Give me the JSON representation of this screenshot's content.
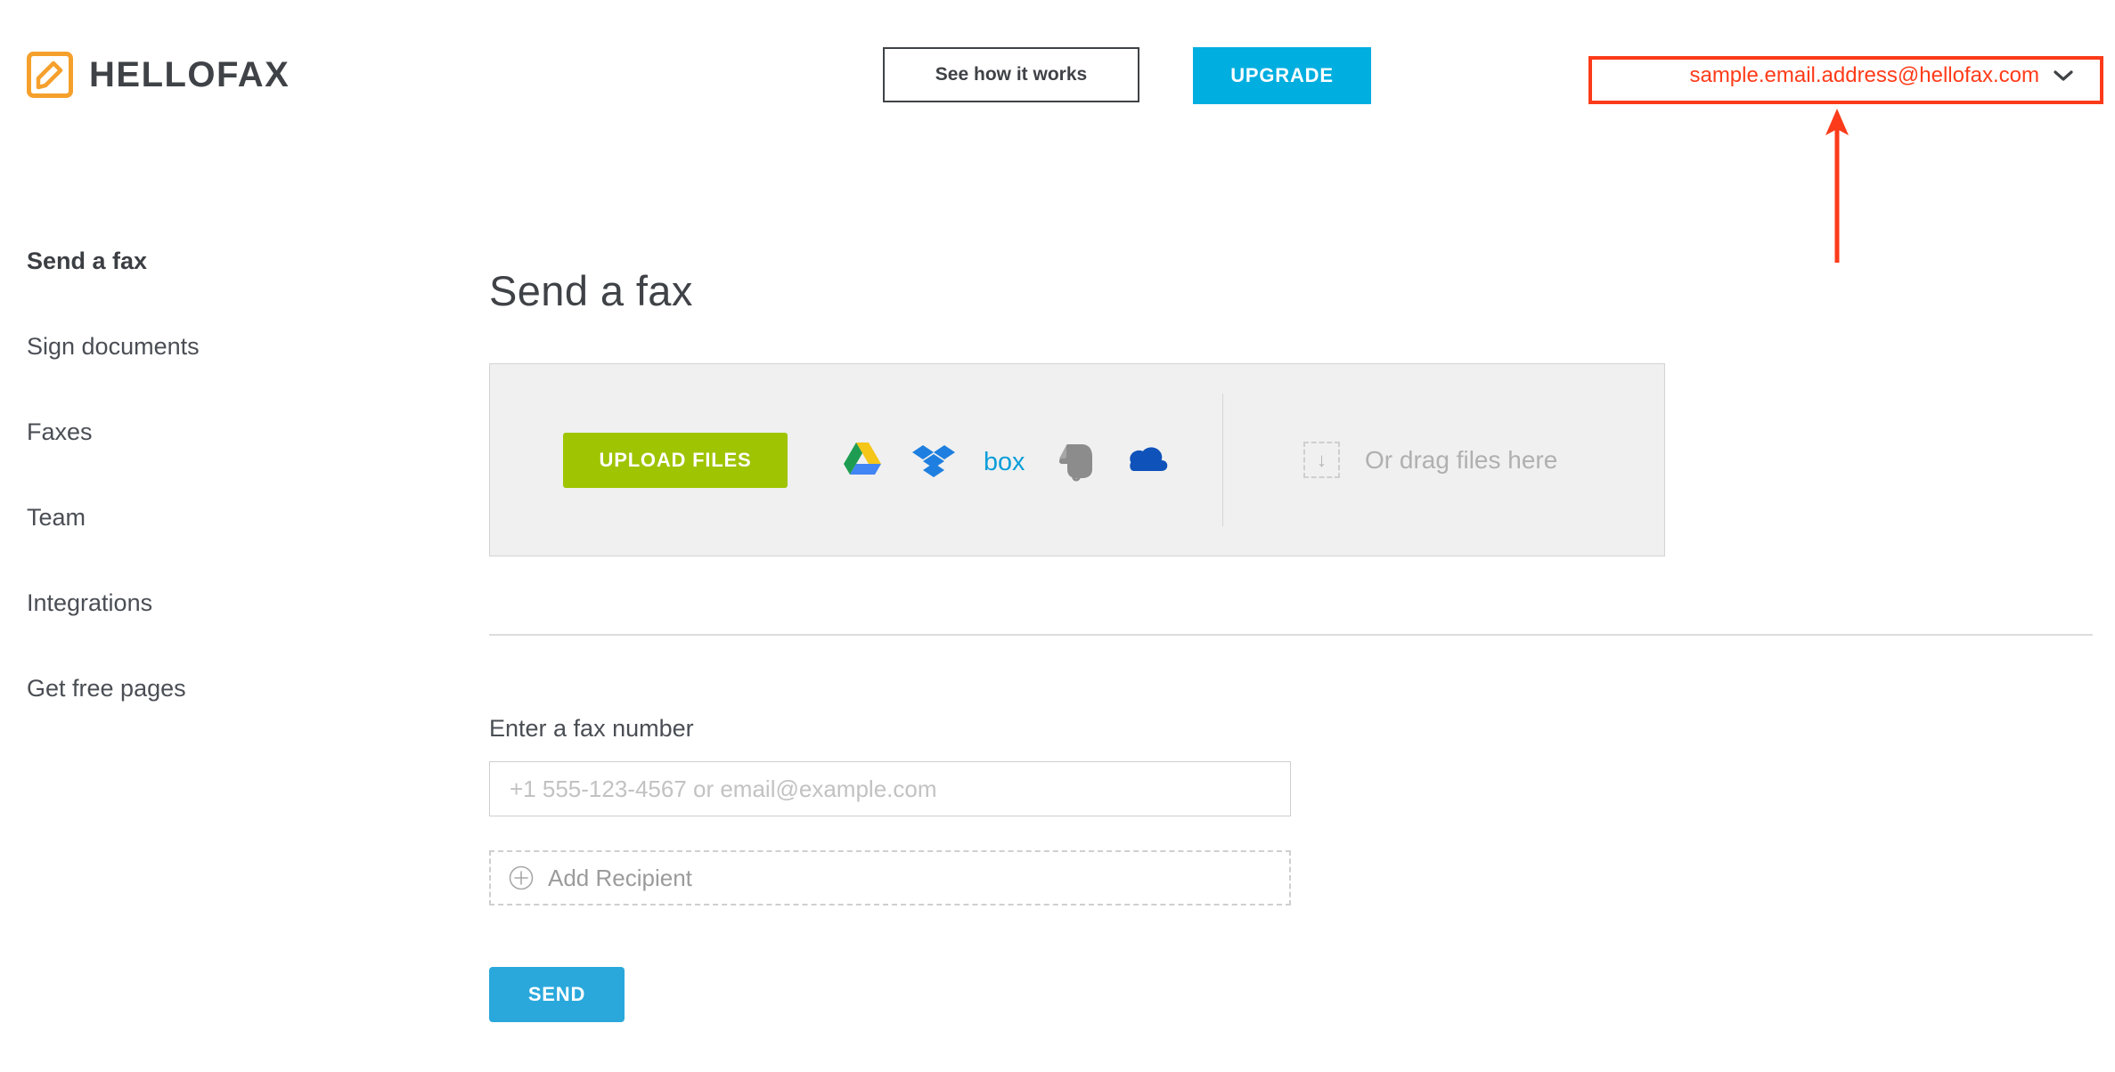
{
  "header": {
    "brand_name": "HELLOFAX",
    "brand_icon": "hellofax-document-pen-icon",
    "see_how_it_works_label": "See how it works",
    "upgrade_label": "UPGRADE",
    "account_email": "sample.email.address@hellofax.com",
    "account_chevron_icon": "chevron-down-icon"
  },
  "annotation": {
    "highlight_color": "#fb3b1a",
    "target": "account-email-dropdown",
    "arrow_icon": "up-arrow-annotation"
  },
  "sidebar": {
    "items": [
      {
        "label": "Send a fax",
        "active": true
      },
      {
        "label": "Sign documents",
        "active": false
      },
      {
        "label": "Faxes",
        "active": false
      },
      {
        "label": "Team",
        "active": false
      },
      {
        "label": "Integrations",
        "active": false
      },
      {
        "label": "Get free pages",
        "active": false
      }
    ]
  },
  "main": {
    "page_title": "Send a fax",
    "upload": {
      "upload_button_label": "UPLOAD FILES",
      "cloud_services": [
        {
          "name": "google-drive",
          "label": "Google Drive"
        },
        {
          "name": "dropbox",
          "label": "Dropbox"
        },
        {
          "name": "box",
          "label": "Box"
        },
        {
          "name": "evernote",
          "label": "Evernote"
        },
        {
          "name": "onedrive",
          "label": "OneDrive"
        }
      ],
      "dropzone_icon": "download-arrow-icon",
      "dropzone_label": "Or drag files here"
    },
    "fax_form": {
      "fax_number_label": "Enter a fax number",
      "fax_number_value": "",
      "fax_number_placeholder": "+1 555-123-4567 or email@example.com",
      "add_recipient_label": "Add Recipient",
      "add_recipient_icon": "plus-circle-icon",
      "send_label": "SEND"
    }
  },
  "colors": {
    "brand_orange": "#f5a02c",
    "upgrade_blue": "#00AEE0",
    "send_blue": "#2aa8dc",
    "upload_green": "#9fc402",
    "annotation_red": "#fb3b1a",
    "panel_grey": "#f0f0f0"
  }
}
